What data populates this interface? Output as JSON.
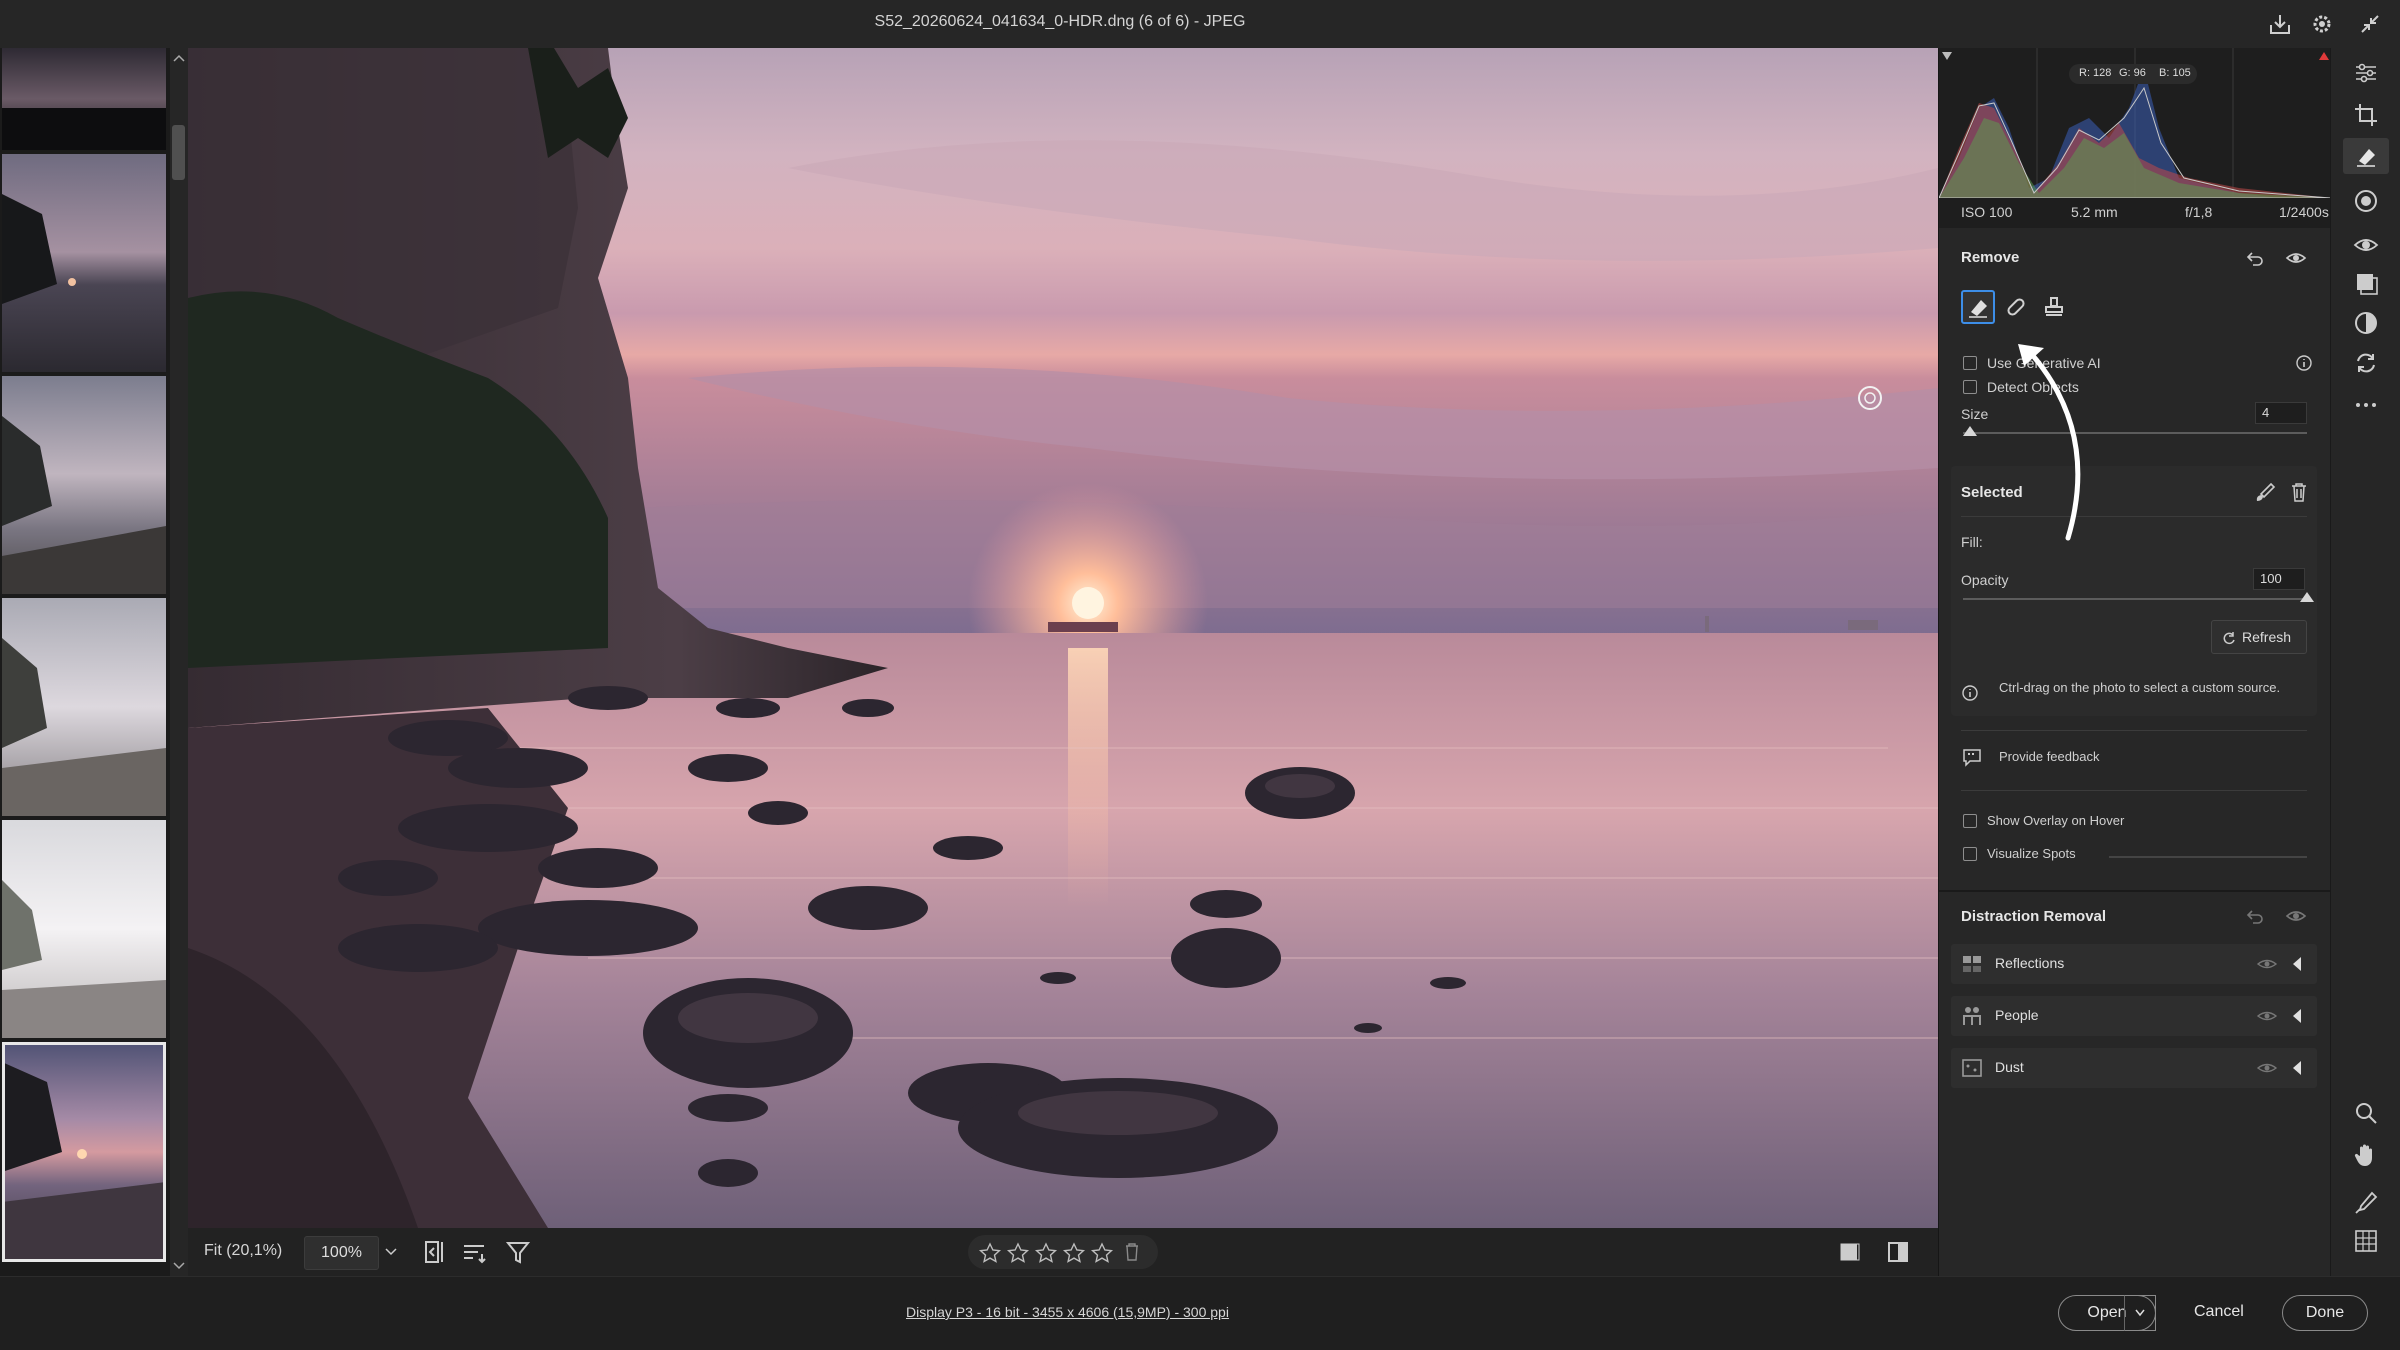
{
  "title": "S52_20260624_041634_0-HDR.dng (6 of 6)  -  JPEG",
  "histogram": {
    "readout": {
      "r": "R: 128",
      "g": "G: 96",
      "b": "B: 105"
    },
    "iso": "ISO 100",
    "focal": "5.2 mm",
    "aperture": "f/1,8",
    "shutter": "1/2400s"
  },
  "remove": {
    "title": "Remove",
    "use_generative_ai": "Use Generative AI",
    "detect_objects": "Detect Objects",
    "size_label": "Size",
    "size_value": "4",
    "size_level": 0.02,
    "selected_title": "Selected",
    "fill_label": "Fill:",
    "opacity_label": "Opacity",
    "opacity_value": "100",
    "opacity_level": 1.0,
    "refresh_label": "Refresh",
    "hint": "Ctrl-drag on the photo to select a custom source.",
    "feedback": "Provide feedback",
    "show_overlay": "Show Overlay on Hover",
    "visualize_spots": "Visualize Spots"
  },
  "distraction": {
    "title": "Distraction Removal",
    "items": [
      {
        "label": "Reflections",
        "icon": "reflections-icon"
      },
      {
        "label": "People",
        "icon": "people-icon"
      },
      {
        "label": "Dust",
        "icon": "dust-icon"
      }
    ]
  },
  "bottom": {
    "fit": "Fit (20,1%)",
    "zoom": "100%",
    "rating": 0
  },
  "footer": {
    "info": "Display P3 - 16 bit - 3455 x 4606 (15,9MP) - 300 ppi",
    "open": "Open",
    "cancel": "Cancel",
    "done": "Done"
  },
  "colors": {
    "accent": "#3d8ee8",
    "panel_bg": "#272727",
    "app_bg": "#1f1f1f"
  }
}
